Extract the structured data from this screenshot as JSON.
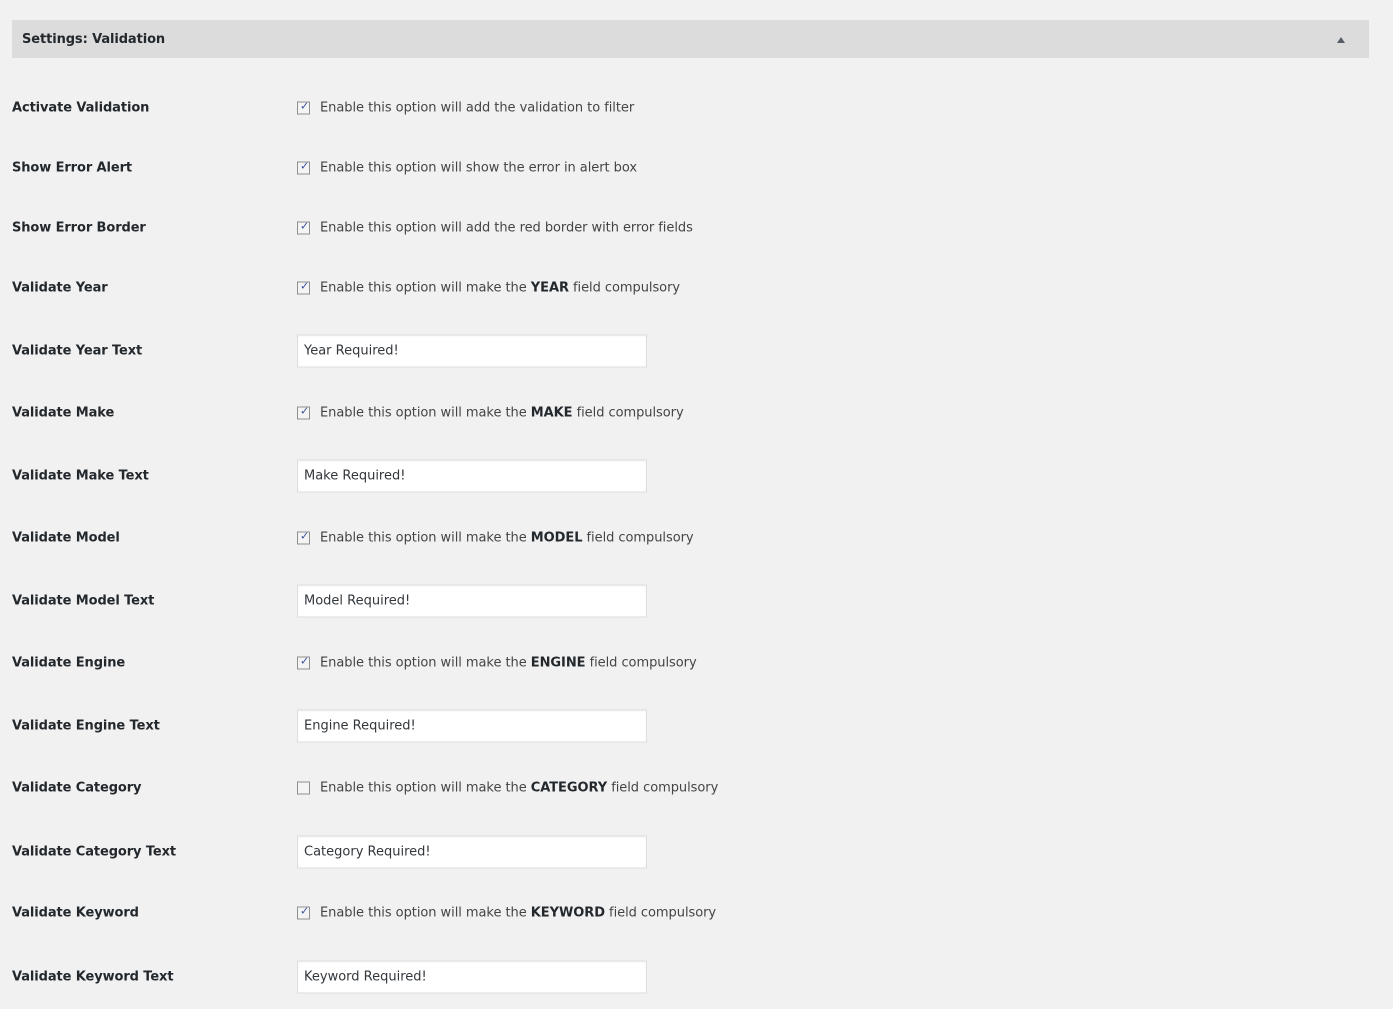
{
  "panel": {
    "title": "Settings: Validation",
    "collapse_icon": "triangle-up-icon"
  },
  "rows": [
    {
      "label": "Activate Validation",
      "type": "checkbox",
      "checked": true,
      "desc_pre": "Enable this option will add the validation to filter",
      "desc_bold": "",
      "desc_post": ""
    },
    {
      "label": "Show Error Alert",
      "type": "checkbox",
      "checked": true,
      "desc_pre": "Enable this option will show the error in alert box",
      "desc_bold": "",
      "desc_post": ""
    },
    {
      "label": "Show Error Border",
      "type": "checkbox",
      "checked": true,
      "desc_pre": "Enable this option will add the red border with error fields",
      "desc_bold": "",
      "desc_post": ""
    },
    {
      "label": "Validate Year",
      "type": "checkbox",
      "checked": true,
      "desc_pre": "Enable this option will make the ",
      "desc_bold": "YEAR",
      "desc_post": " field compulsory"
    },
    {
      "label": "Validate Year Text",
      "type": "text",
      "value": "Year Required!"
    },
    {
      "label": "Validate Make",
      "type": "checkbox",
      "checked": true,
      "desc_pre": "Enable this option will make the ",
      "desc_bold": "MAKE",
      "desc_post": " field compulsory"
    },
    {
      "label": "Validate Make Text",
      "type": "text",
      "value": "Make Required!"
    },
    {
      "label": "Validate Model",
      "type": "checkbox",
      "checked": true,
      "desc_pre": "Enable this option will make the ",
      "desc_bold": "MODEL",
      "desc_post": " field compulsory"
    },
    {
      "label": "Validate Model Text",
      "type": "text",
      "value": "Model Required!"
    },
    {
      "label": "Validate Engine",
      "type": "checkbox",
      "checked": true,
      "desc_pre": "Enable this option will make the ",
      "desc_bold": "ENGINE",
      "desc_post": " field compulsory"
    },
    {
      "label": "Validate Engine Text",
      "type": "text",
      "value": "Engine Required!"
    },
    {
      "label": "Validate Category",
      "type": "checkbox",
      "checked": false,
      "desc_pre": "Enable this option will make the ",
      "desc_bold": "CATEGORY",
      "desc_post": " field compulsory"
    },
    {
      "label": "Validate Category Text",
      "type": "text",
      "value": "Category Required!"
    },
    {
      "label": "Validate Keyword",
      "type": "checkbox",
      "checked": true,
      "desc_pre": "Enable this option will make the ",
      "desc_bold": "KEYWORD",
      "desc_post": " field compulsory"
    },
    {
      "label": "Validate Keyword Text",
      "type": "text",
      "value": "Keyword Required!"
    }
  ]
}
